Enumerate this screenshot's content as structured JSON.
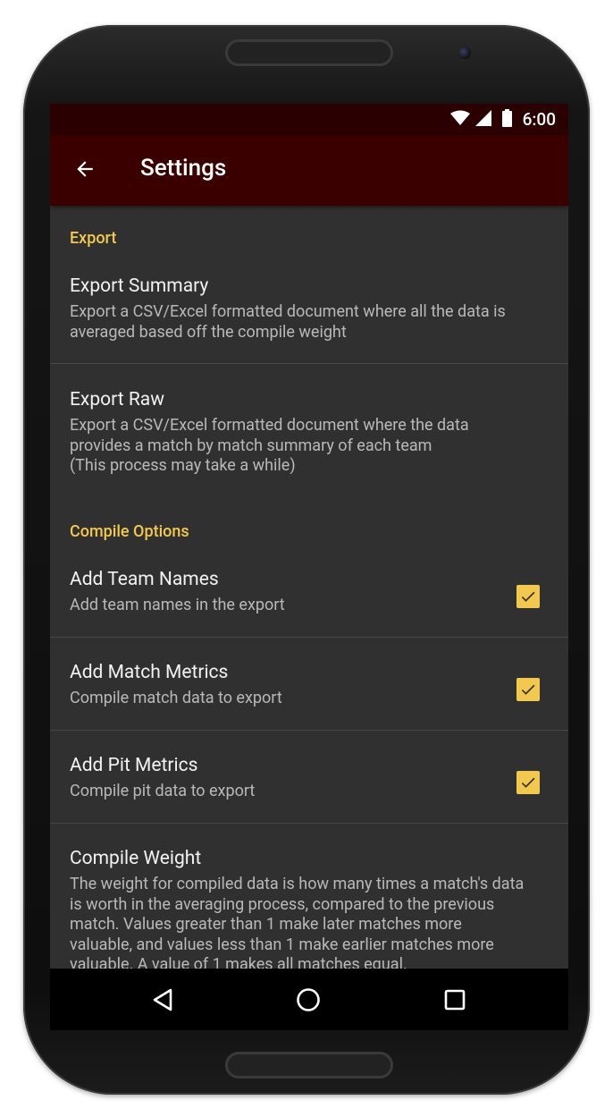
{
  "status_bar": {
    "time": "6:00"
  },
  "app_bar": {
    "title": "Settings"
  },
  "sections": {
    "export": {
      "header": "Export",
      "summary_pref": {
        "title": "Export Summary",
        "summary": "Export a CSV/Excel formatted document where all the data is averaged based off the compile weight"
      },
      "raw_pref": {
        "title": "Export Raw",
        "summary_line1": "Export a CSV/Excel formatted document where the data provides a match by match summary of each team",
        "summary_line2": "(This process may take a while)"
      }
    },
    "compile": {
      "header": "Compile Options",
      "team_names": {
        "title": "Add Team Names",
        "summary": "Add team names in the export",
        "checked": true
      },
      "match_metrics": {
        "title": "Add Match Metrics",
        "summary": "Compile match data to export",
        "checked": true
      },
      "pit_metrics": {
        "title": "Add Pit Metrics",
        "summary": "Compile pit data to export",
        "checked": true
      },
      "weight": {
        "title": "Compile Weight",
        "summary": "The weight for compiled data is how many times a match's data is worth in the averaging process, compared to the previous match. Values greater than 1 make later matches more valuable, and values less than 1 make earlier matches more valuable. A value of 1 makes all matches equal."
      }
    }
  },
  "colors": {
    "accent": "#f2c94c",
    "app_bar": "#3a0000",
    "status_bar": "#2a0000",
    "background": "#303030"
  },
  "icons": {
    "back": "arrow-back-icon",
    "checkbox": "check-icon",
    "nav_back": "triangle-back-icon",
    "nav_home": "circle-home-icon",
    "nav_recents": "square-recents-icon"
  }
}
